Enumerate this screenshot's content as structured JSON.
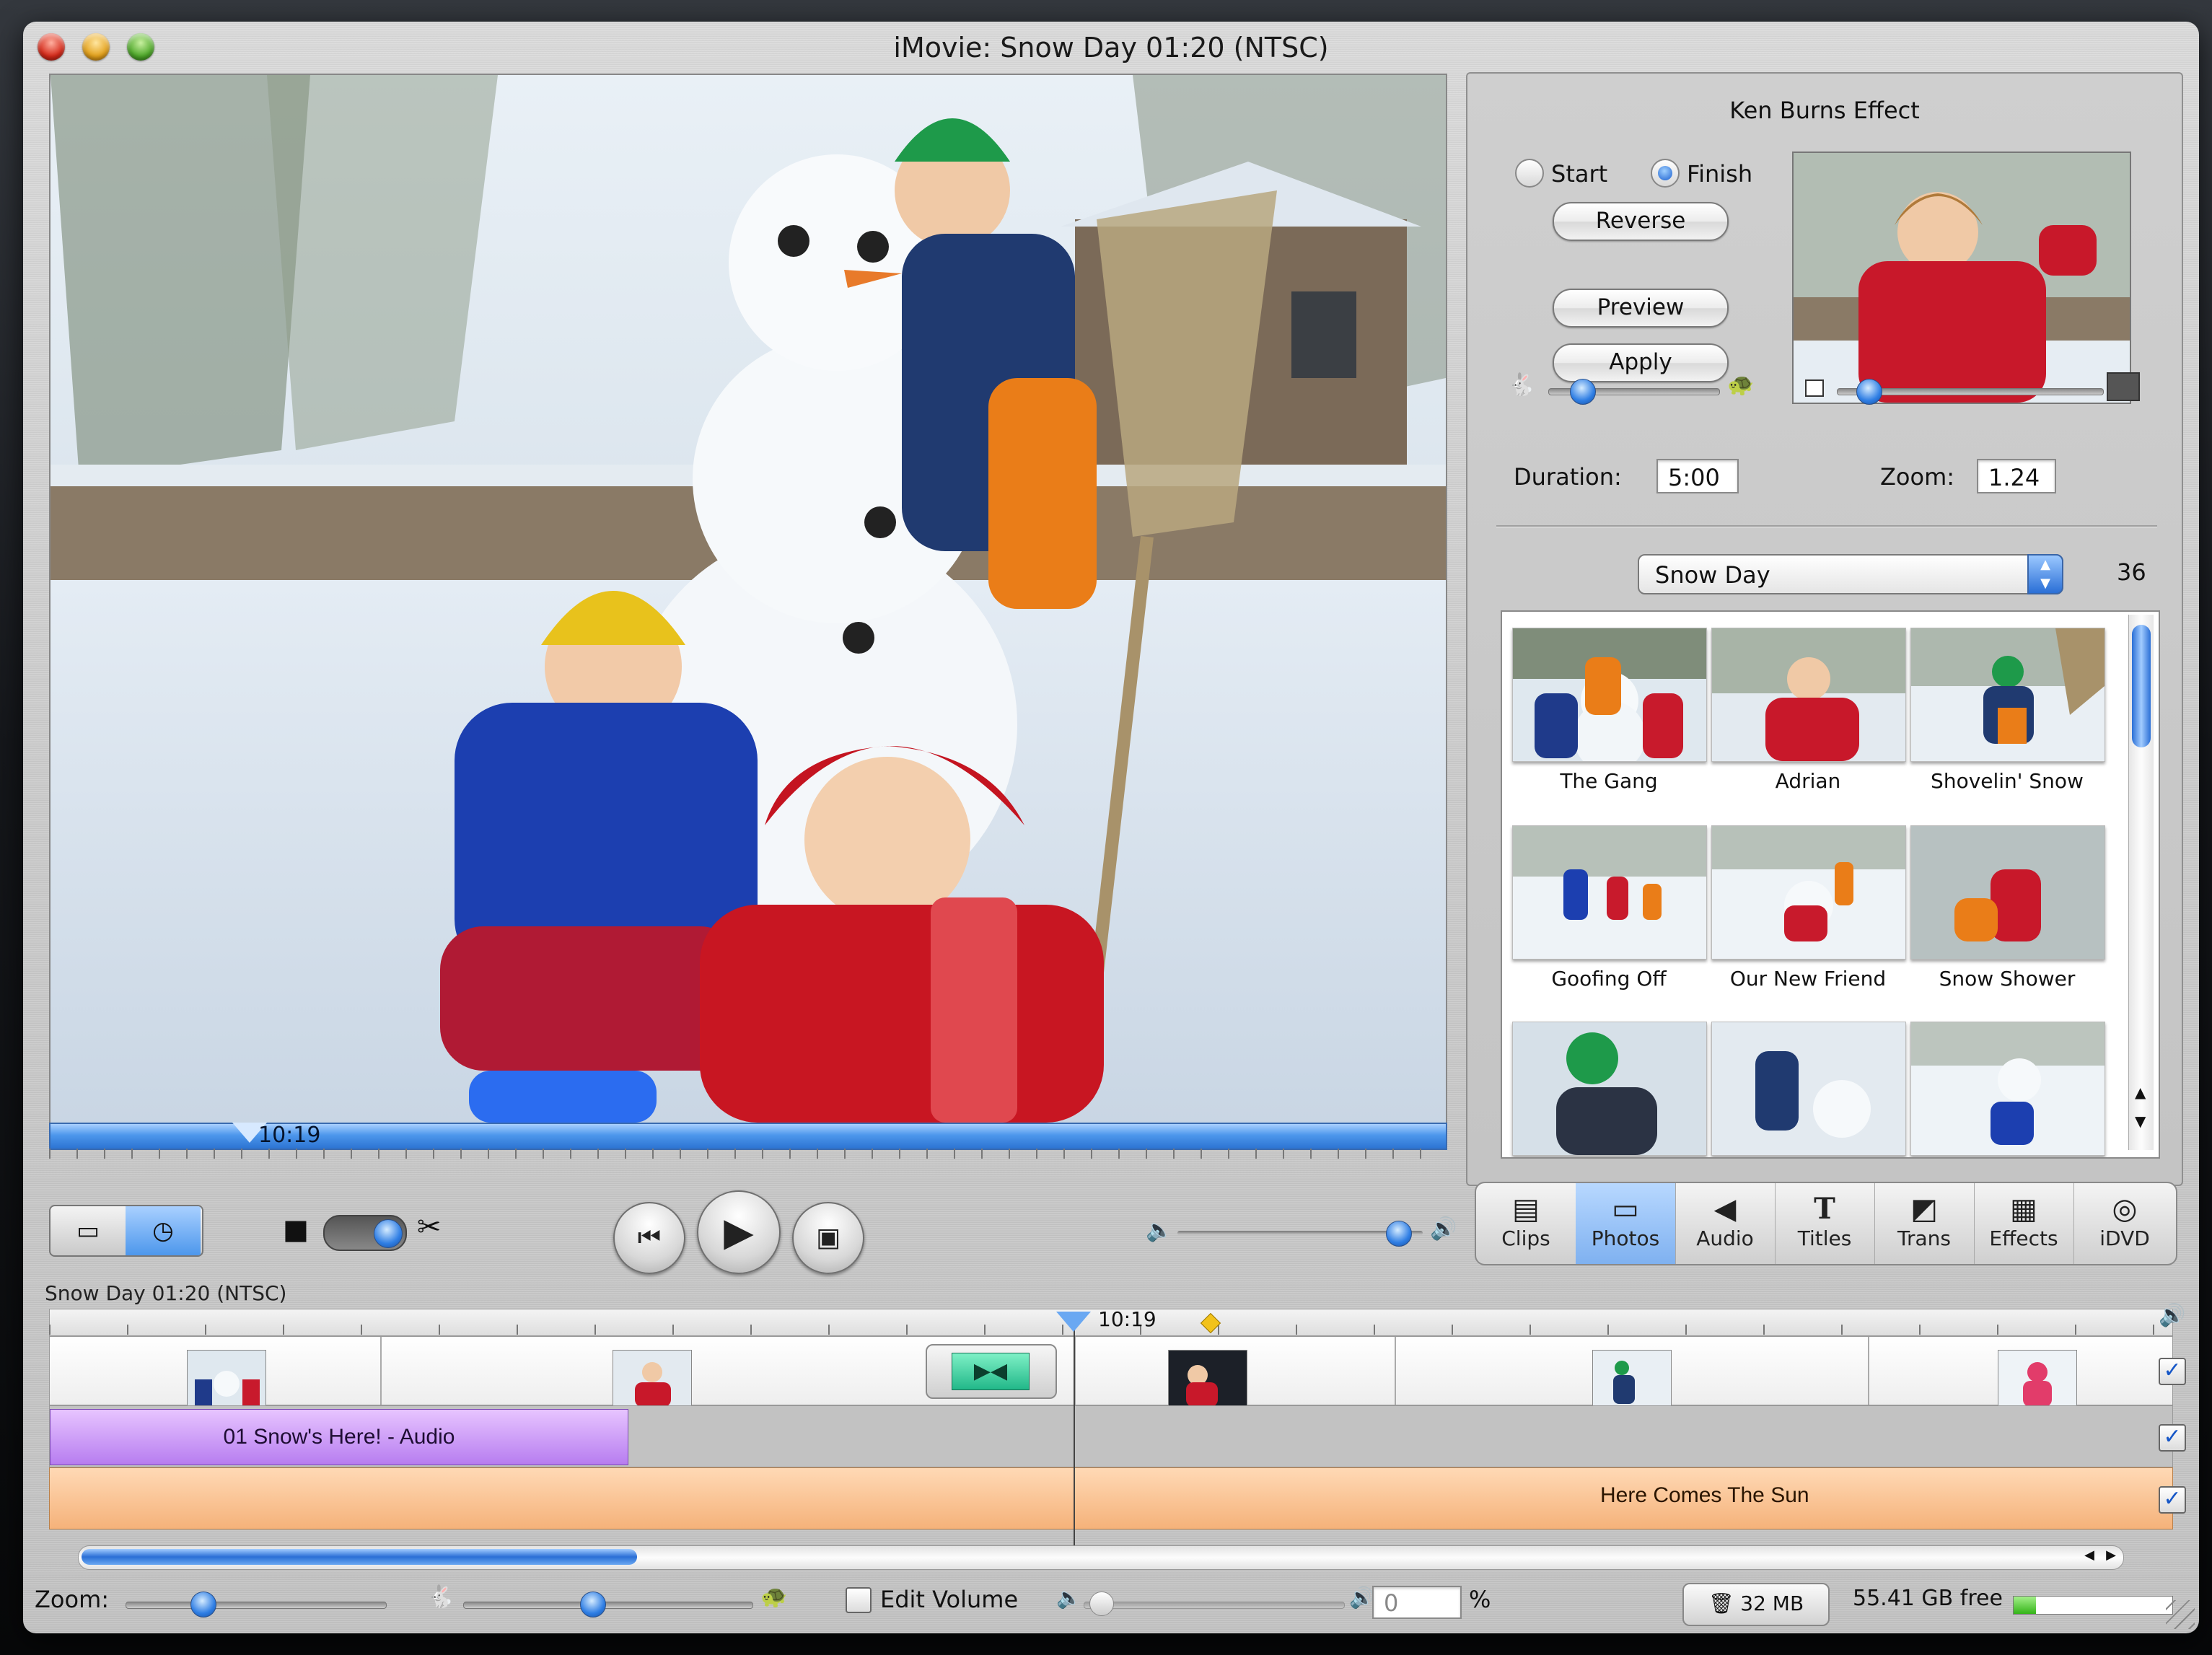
{
  "window": {
    "title": "iMovie: Snow Day  01:20 (NTSC)"
  },
  "viewer": {
    "scrubber_time": "10:19"
  },
  "ken_burns": {
    "title": "Ken Burns Effect",
    "start_label": "Start",
    "finish_label": "Finish",
    "selected": "Finish",
    "reverse_label": "Reverse",
    "preview_label": "Preview",
    "apply_label": "Apply",
    "duration_label": "Duration:",
    "duration_value": "5:00",
    "zoom_label": "Zoom:",
    "zoom_value": "1.24",
    "speed_slider_level": 0.2,
    "zoom_slider_level": 0.12
  },
  "photos": {
    "album": "Snow Day",
    "count": "36",
    "items": [
      {
        "name": "The Gang"
      },
      {
        "name": "Adrian"
      },
      {
        "name": "Shovelin' Snow"
      },
      {
        "name": "Goofing Off"
      },
      {
        "name": "Our New Friend"
      },
      {
        "name": "Snow Shower"
      }
    ]
  },
  "tabs": [
    {
      "label": "Clips",
      "icon": "filmstrip-icon"
    },
    {
      "label": "Photos",
      "icon": "photo-frame-icon",
      "selected": true
    },
    {
      "label": "Audio",
      "icon": "speaker-icon"
    },
    {
      "label": "Titles",
      "icon": "title-t-icon"
    },
    {
      "label": "Trans",
      "icon": "transition-icon"
    },
    {
      "label": "Effects",
      "icon": "effects-checker-icon"
    },
    {
      "label": "iDVD",
      "icon": "dvd-disc-icon"
    }
  ],
  "timeline": {
    "project_label": "Snow Day  01:20 (NTSC)",
    "playhead_time": "10:19",
    "audio_track_1_clip": "01 Snow's Here! - Audio",
    "audio_track_2_clip": "Here Comes The Sun",
    "volume_level": 0.9
  },
  "bottom": {
    "zoom_label": "Zoom:",
    "edit_volume_label": "Edit Volume",
    "volume_value": "0",
    "percent_sign": "%",
    "trash_size": "32 MB",
    "free_space": "55.41 GB free",
    "disk_used_level": 0.14
  },
  "colors": {
    "accent_blue": "#2f7ee4",
    "audio_track_1": "#b77df0",
    "audio_track_2": "#f5b27a",
    "transition": "#22b889"
  }
}
